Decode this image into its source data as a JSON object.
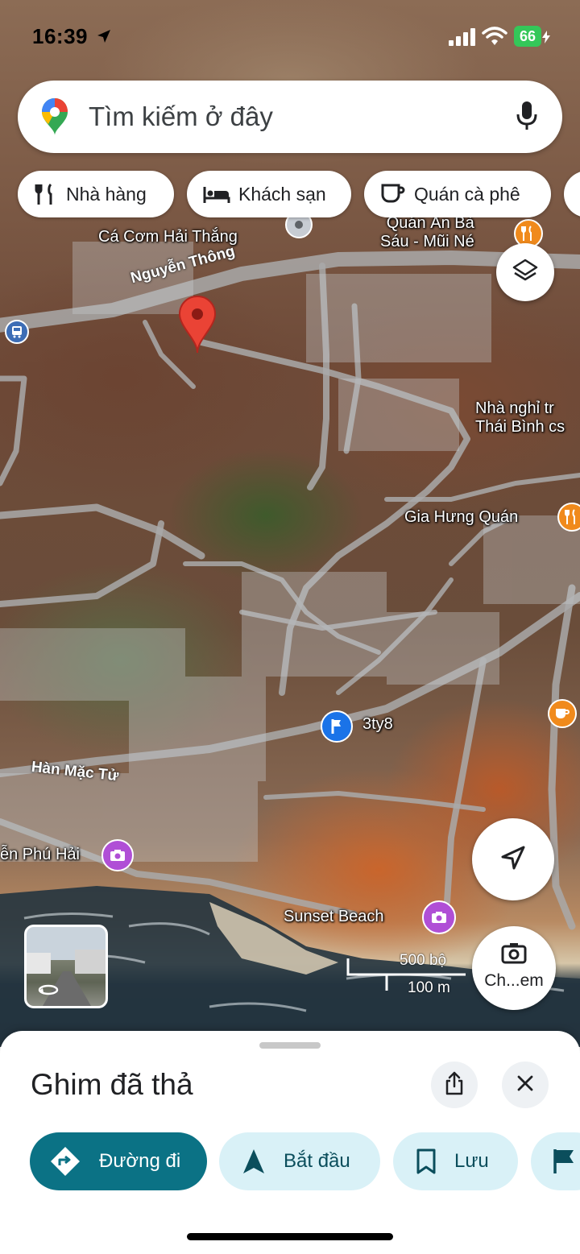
{
  "status_bar": {
    "time": "16:39",
    "battery": "66"
  },
  "search": {
    "placeholder": "Tìm kiếm ở đây",
    "logo_icon": "google-maps-pin-icon",
    "mic_icon": "microphone-icon"
  },
  "chips": [
    {
      "label": "Nhà hàng",
      "icon": "restaurant-icon"
    },
    {
      "label": "Khách sạn",
      "icon": "hotel-bed-icon"
    },
    {
      "label": "Quán cà phê",
      "icon": "coffee-cup-icon"
    }
  ],
  "map": {
    "places": {
      "top_left_partial": "Cá Cơm Hải Thắng",
      "quan_an": "Quán Ăn Bà\nSáu - Mũi Né",
      "nha_nghi": "Nhà nghỉ tr\nThái Bình cs",
      "gia_hung": "Gia Hưng Quán",
      "pin_3ty8": "3ty8",
      "phu_hai": "ễn Phú Hải",
      "sunset_beach": "Sunset Beach"
    },
    "roads": {
      "nguyen_thong": "Nguyễn Thông",
      "han_mac_tu": "Hàn Mặc Tử"
    },
    "scale": {
      "imperial": "500 bộ",
      "metric": "100 m"
    },
    "dropped_pin_color": "#ea4335",
    "camera_button_label": "Ch...em"
  },
  "sheet": {
    "title": "Ghim đã thả",
    "share_icon": "share-icon",
    "close_icon": "close-icon",
    "actions": [
      {
        "label": "Đường đi",
        "icon": "directions-icon",
        "primary": true
      },
      {
        "label": "Bắt đầu",
        "icon": "navigation-arrow-icon",
        "primary": false
      },
      {
        "label": "Lưu",
        "icon": "bookmark-icon",
        "primary": false
      }
    ]
  },
  "colors": {
    "primary_teal": "#0b7285",
    "chip_tint": "#d9f1f7",
    "poi_orange": "#f08a1c",
    "poi_purple": "#b04fd6"
  }
}
